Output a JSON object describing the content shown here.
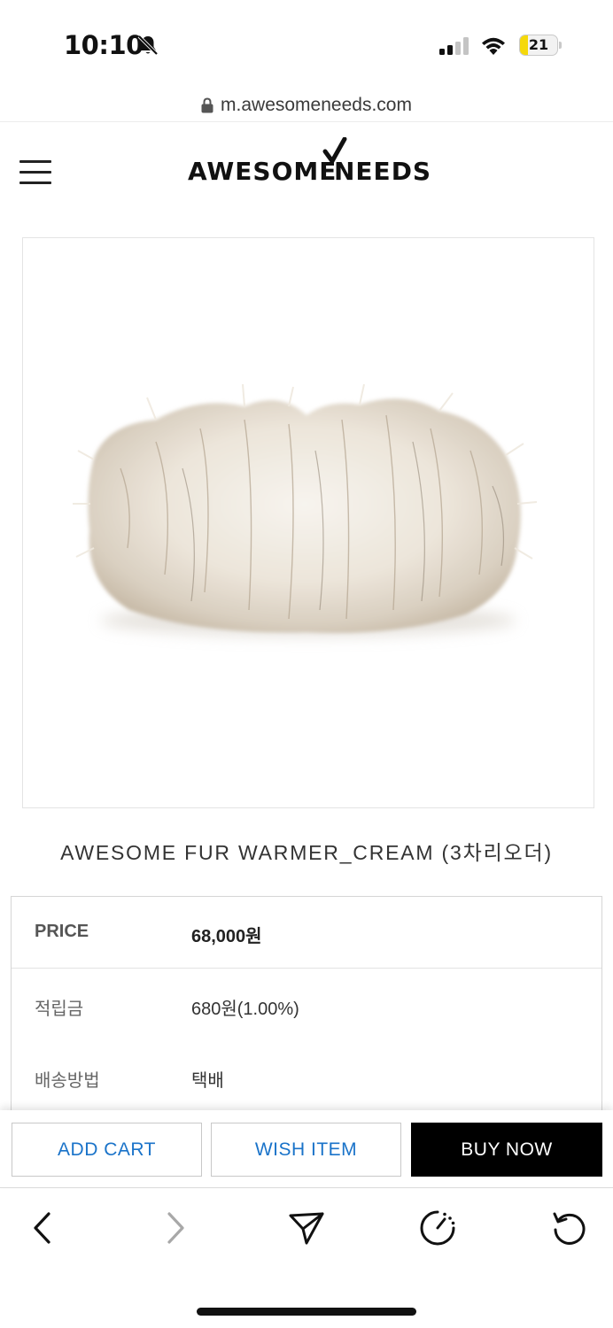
{
  "status_bar": {
    "time": "10:10",
    "battery_level": "21",
    "battery_color": "#f5d90a",
    "icons": [
      "bell-slash-icon",
      "signal-icon",
      "wifi-icon",
      "battery-icon"
    ]
  },
  "browser": {
    "url": "m.awesomeneeds.com"
  },
  "header": {
    "logo_word_1": "AWESOME",
    "logo_word_2": "NEEDS"
  },
  "product": {
    "name": "AWESOME FUR WARMER_CREAM (3차리오더)",
    "info": [
      {
        "label": "PRICE",
        "value": "68,000원"
      },
      {
        "label": "적립금",
        "value": "680원(1.00%)"
      },
      {
        "label": "배송방법",
        "value": "택배"
      }
    ]
  },
  "actions": {
    "add_cart": "ADD CART",
    "wish_item": "WISH ITEM",
    "buy_now": "BUY NOW",
    "accent_color": "#1a73c9"
  },
  "toolbar": {
    "icons": [
      "back-icon",
      "forward-icon",
      "share-icon",
      "speed-icon",
      "reload-icon"
    ]
  }
}
